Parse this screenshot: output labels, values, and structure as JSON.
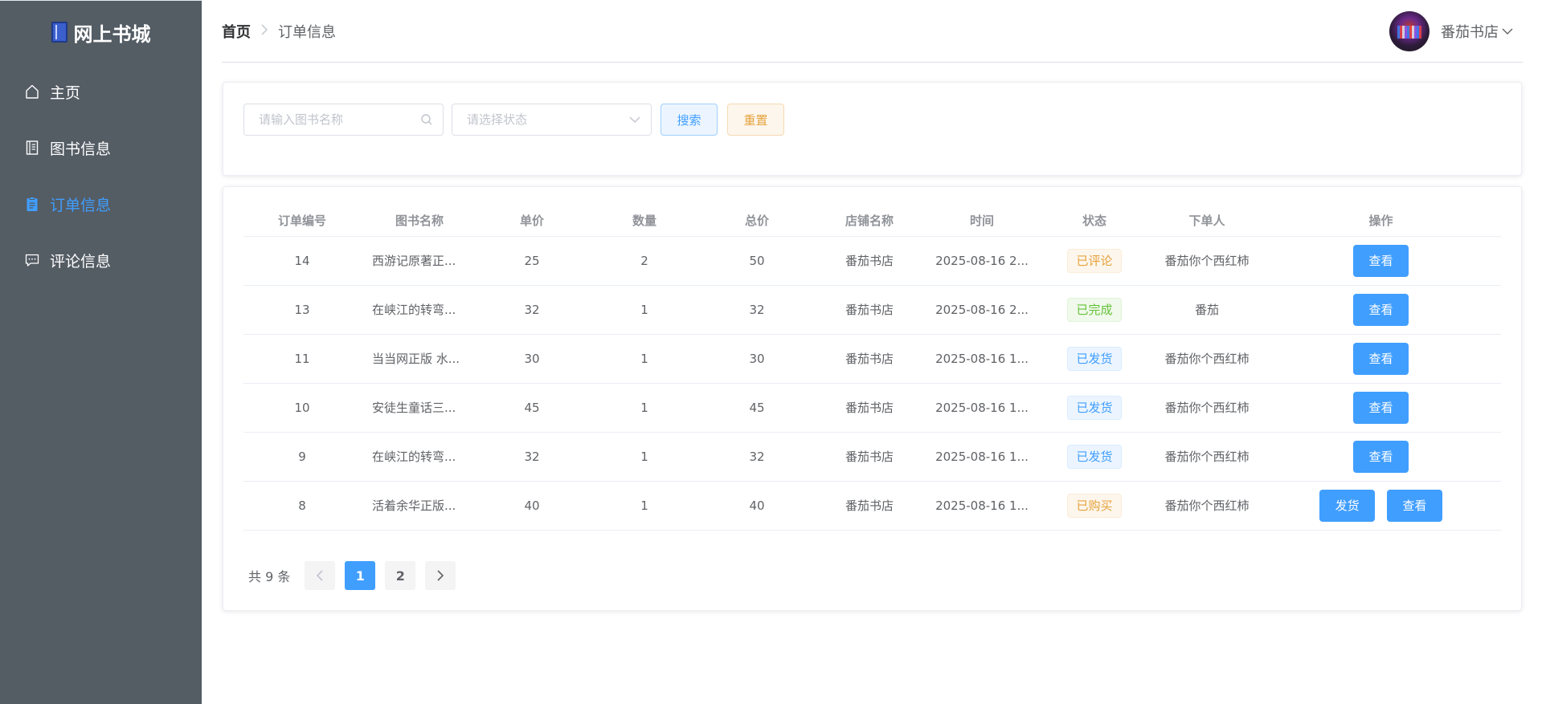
{
  "sidebar": {
    "logo_text": "网上书城",
    "items": [
      {
        "label": "主页",
        "icon": "home-icon",
        "active": false
      },
      {
        "label": "图书信息",
        "icon": "document-icon",
        "active": false
      },
      {
        "label": "订单信息",
        "icon": "clipboard-icon",
        "active": true
      },
      {
        "label": "评论信息",
        "icon": "chat-icon",
        "active": false
      }
    ]
  },
  "header": {
    "breadcrumb": {
      "home": "首页",
      "current": "订单信息"
    },
    "user_name": "番茄书店"
  },
  "search": {
    "book_placeholder": "请输入图书名称",
    "status_placeholder": "请选择状态",
    "search_label": "搜索",
    "reset_label": "重置"
  },
  "table": {
    "columns": [
      "订单编号",
      "图书名称",
      "单价",
      "数量",
      "总价",
      "店铺名称",
      "时间",
      "状态",
      "下单人",
      "操作"
    ],
    "rows": [
      {
        "id": "14",
        "book": "西游记原著正...",
        "price": "25",
        "qty": "2",
        "total": "50",
        "shop": "番茄书店",
        "time": "2025-08-16 2...",
        "status": "已评论",
        "status_type": "warning",
        "buyer": "番茄你个西红柿",
        "ship": false
      },
      {
        "id": "13",
        "book": "在峡江的转弯...",
        "price": "32",
        "qty": "1",
        "total": "32",
        "shop": "番茄书店",
        "time": "2025-08-16 2...",
        "status": "已完成",
        "status_type": "success",
        "buyer": "番茄",
        "ship": false
      },
      {
        "id": "11",
        "book": "当当网正版 水...",
        "price": "30",
        "qty": "1",
        "total": "30",
        "shop": "番茄书店",
        "time": "2025-08-16 1...",
        "status": "已发货",
        "status_type": "info",
        "buyer": "番茄你个西红柿",
        "ship": false
      },
      {
        "id": "10",
        "book": "安徒生童话三...",
        "price": "45",
        "qty": "1",
        "total": "45",
        "shop": "番茄书店",
        "time": "2025-08-16 1...",
        "status": "已发货",
        "status_type": "info",
        "buyer": "番茄你个西红柿",
        "ship": false
      },
      {
        "id": "9",
        "book": "在峡江的转弯...",
        "price": "32",
        "qty": "1",
        "total": "32",
        "shop": "番茄书店",
        "time": "2025-08-16 1...",
        "status": "已发货",
        "status_type": "info",
        "buyer": "番茄你个西红柿",
        "ship": false
      },
      {
        "id": "8",
        "book": "活着余华正版...",
        "price": "40",
        "qty": "1",
        "total": "40",
        "shop": "番茄书店",
        "time": "2025-08-16 1...",
        "status": "已购买",
        "status_type": "warning",
        "buyer": "番茄你个西红柿",
        "ship": true
      }
    ],
    "view_label": "查看",
    "ship_label": "发货"
  },
  "pagination": {
    "total_text": "共 9 条",
    "pages": [
      "1",
      "2"
    ],
    "current": "1"
  },
  "colors": {
    "sidebar_bg": "#545c64",
    "accent": "#409eff",
    "warning": "#e6a23c",
    "success": "#67c23a"
  }
}
